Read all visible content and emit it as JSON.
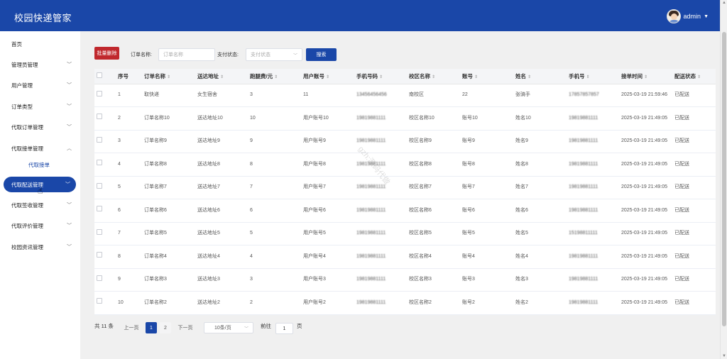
{
  "header": {
    "title": "校园快递管家",
    "user": "admin"
  },
  "sidebar": {
    "items": [
      {
        "label": "首页",
        "has_arrow": false
      },
      {
        "label": "管理员管理",
        "has_arrow": true
      },
      {
        "label": "用户管理",
        "has_arrow": true
      },
      {
        "label": "订单类型",
        "has_arrow": true
      },
      {
        "label": "代取订单管理",
        "has_arrow": true
      },
      {
        "label": "代取接单管理",
        "has_arrow": true,
        "expanded": true
      },
      {
        "label": "代取配送管理",
        "has_arrow": true,
        "active": true
      },
      {
        "label": "代取签收管理",
        "has_arrow": true
      },
      {
        "label": "代取评价管理",
        "has_arrow": true
      },
      {
        "label": "校园资讯管理",
        "has_arrow": true
      }
    ],
    "sub_item": "代取接单"
  },
  "toolbar": {
    "delete_label": "批量删除",
    "order_name_label": "订单名称:",
    "order_name_placeholder": "订单名称",
    "pay_status_label": "支付状态:",
    "pay_status_placeholder": "支付状态",
    "search_label": "搜索"
  },
  "table": {
    "columns": [
      "",
      "序号",
      "订单名称",
      "送达地址",
      "跑腿费/元",
      "用户账号",
      "手机号码",
      "校区名称",
      "账号",
      "姓名",
      "手机号",
      "接单时间",
      "配送状态"
    ],
    "sortable": [
      false,
      false,
      true,
      true,
      true,
      true,
      true,
      true,
      true,
      true,
      true,
      true,
      true
    ],
    "rows": [
      [
        "1",
        "取快递",
        "女生宿舍",
        "3",
        "11",
        "13456456456",
        "南校区",
        "22",
        "张骑手",
        "17857857857",
        "2025-03-19 21:59:46",
        "已配送"
      ],
      [
        "2",
        "订单名称10",
        "送达地址10",
        "10",
        "用户账号10",
        "19819881111",
        "校区名称10",
        "账号10",
        "姓名10",
        "19819881111",
        "2025-03-19 21:49:05",
        "已配送"
      ],
      [
        "3",
        "订单名称9",
        "送达地址9",
        "9",
        "用户账号9",
        "19819881111",
        "校区名称9",
        "账号9",
        "姓名9",
        "19819881111",
        "2025-03-19 21:49:05",
        "已配送"
      ],
      [
        "4",
        "订单名称8",
        "送达地址8",
        "8",
        "用户账号8",
        "19819881111",
        "校区名称8",
        "账号8",
        "姓名8",
        "19819881111",
        "2025-03-19 21:49:05",
        "已配送"
      ],
      [
        "5",
        "订单名称7",
        "送达地址7",
        "7",
        "用户账号7",
        "19819881111",
        "校区名称7",
        "账号7",
        "姓名7",
        "19819881111",
        "2025-03-19 21:49:05",
        "已配送"
      ],
      [
        "6",
        "订单名称6",
        "送达地址6",
        "6",
        "用户账号6",
        "19819881111",
        "校区名称6",
        "账号6",
        "姓名6",
        "19819881111",
        "2025-03-19 21:49:05",
        "已配送"
      ],
      [
        "7",
        "订单名称5",
        "送达地址5",
        "5",
        "用户账号5",
        "19819881111",
        "校区名称5",
        "账号5",
        "姓名5",
        "15198811111",
        "2025-03-19 21:49:05",
        "已配送"
      ],
      [
        "8",
        "订单名称4",
        "送达地址4",
        "4",
        "用户账号4",
        "19819881111",
        "校区名称4",
        "账号4",
        "姓名4",
        "19819881111",
        "2025-03-19 21:49:05",
        "已配送"
      ],
      [
        "9",
        "订单名称3",
        "送达地址3",
        "3",
        "用户账号3",
        "19819881111",
        "校区名称3",
        "账号3",
        "姓名3",
        "19819881111",
        "2025-03-19 21:49:05",
        "已配送"
      ],
      [
        "10",
        "订单名称2",
        "送达地址2",
        "2",
        "用户账号2",
        "19819881111",
        "校区名称2",
        "账号2",
        "姓名2",
        "19819881111",
        "2025-03-19 21:49:05",
        "已配送"
      ]
    ]
  },
  "pagination": {
    "total": "共 11 条",
    "prev": "上一页",
    "pages": [
      "1",
      "2"
    ],
    "next": "下一页",
    "page_size": "10条/页",
    "goto_label": "前往",
    "goto_value": "1",
    "page_unit": "页"
  },
  "watermark": "gzh:源码代做",
  "colors": {
    "primary": "#1a47a8",
    "danger": "#c0282d"
  }
}
